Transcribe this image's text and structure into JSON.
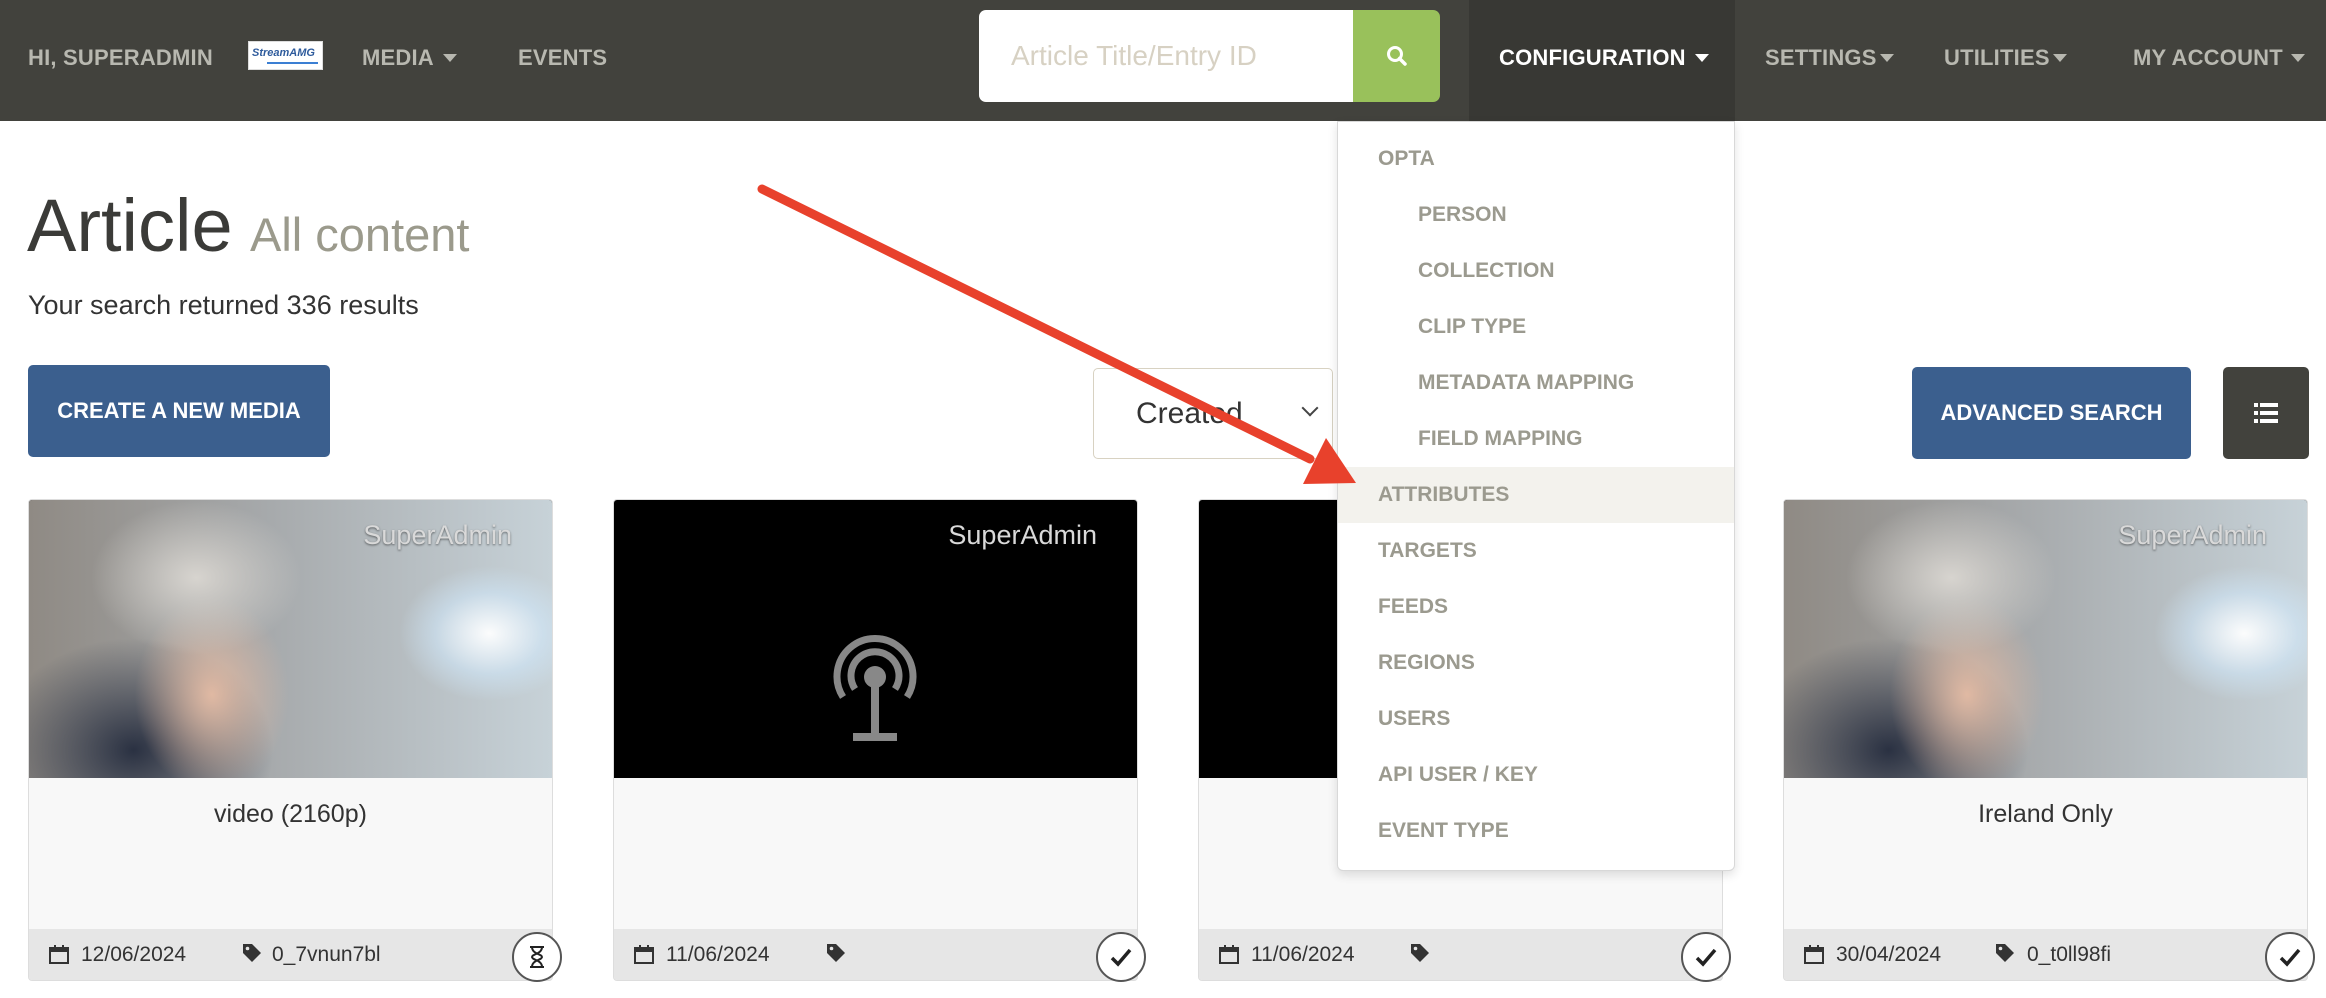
{
  "nav": {
    "greeting": "HI, SUPERADMIN",
    "logo_text": "StreamAMG",
    "media": "MEDIA",
    "events": "EVENTS",
    "configuration": "CONFIGURATION",
    "settings": "SETTINGS",
    "utilities": "UTILITIES",
    "my_account": "MY ACCOUNT"
  },
  "search": {
    "placeholder": "Article Title/Entry ID",
    "icon": "search-icon"
  },
  "page": {
    "title": "Article",
    "subtitle": "All content",
    "results_text": "Your search returned 336 results"
  },
  "toolbar": {
    "create_label": "CREATE A NEW MEDIA",
    "sort_value": "Created",
    "advanced_search_label": "ADVANCED SEARCH",
    "list_view_icon": "list-icon"
  },
  "config_menu": {
    "items": [
      {
        "label": "OPTA",
        "level": "top"
      },
      {
        "label": "PERSON",
        "level": "sub"
      },
      {
        "label": "COLLECTION",
        "level": "sub"
      },
      {
        "label": "CLIP TYPE",
        "level": "sub"
      },
      {
        "label": "METADATA MAPPING",
        "level": "sub"
      },
      {
        "label": "FIELD MAPPING",
        "level": "sub"
      },
      {
        "label": "ATTRIBUTES",
        "level": "top",
        "highlighted": true
      },
      {
        "label": "TARGETS",
        "level": "top"
      },
      {
        "label": "FEEDS",
        "level": "top"
      },
      {
        "label": "REGIONS",
        "level": "top"
      },
      {
        "label": "USERS",
        "level": "top"
      },
      {
        "label": "API USER / KEY",
        "level": "top"
      },
      {
        "label": "EVENT TYPE",
        "level": "top"
      }
    ]
  },
  "cards": [
    {
      "owner": "SuperAdmin",
      "thumb": "vr-photo",
      "title": "video (2160p)",
      "date": "12/06/2024",
      "entry_id": "0_7vnun7bl",
      "status": "hourglass-icon"
    },
    {
      "owner": "SuperAdmin",
      "thumb": "podcast",
      "title": "",
      "date": "11/06/2024",
      "entry_id": "",
      "status": "check-icon"
    },
    {
      "owner": "",
      "thumb": "black",
      "title": "",
      "date": "11/06/2024",
      "entry_id": "",
      "status": "check-icon"
    },
    {
      "owner": "SuperAdmin",
      "thumb": "vr-photo",
      "title": "Ireland Only",
      "date": "30/04/2024",
      "entry_id": "0_t0ll98fi",
      "status": "check-icon"
    }
  ],
  "colors": {
    "navbar": "#42423d",
    "search_button": "#99c15b",
    "primary_button": "#3b5f8e",
    "annotation_arrow": "#e8412c"
  }
}
